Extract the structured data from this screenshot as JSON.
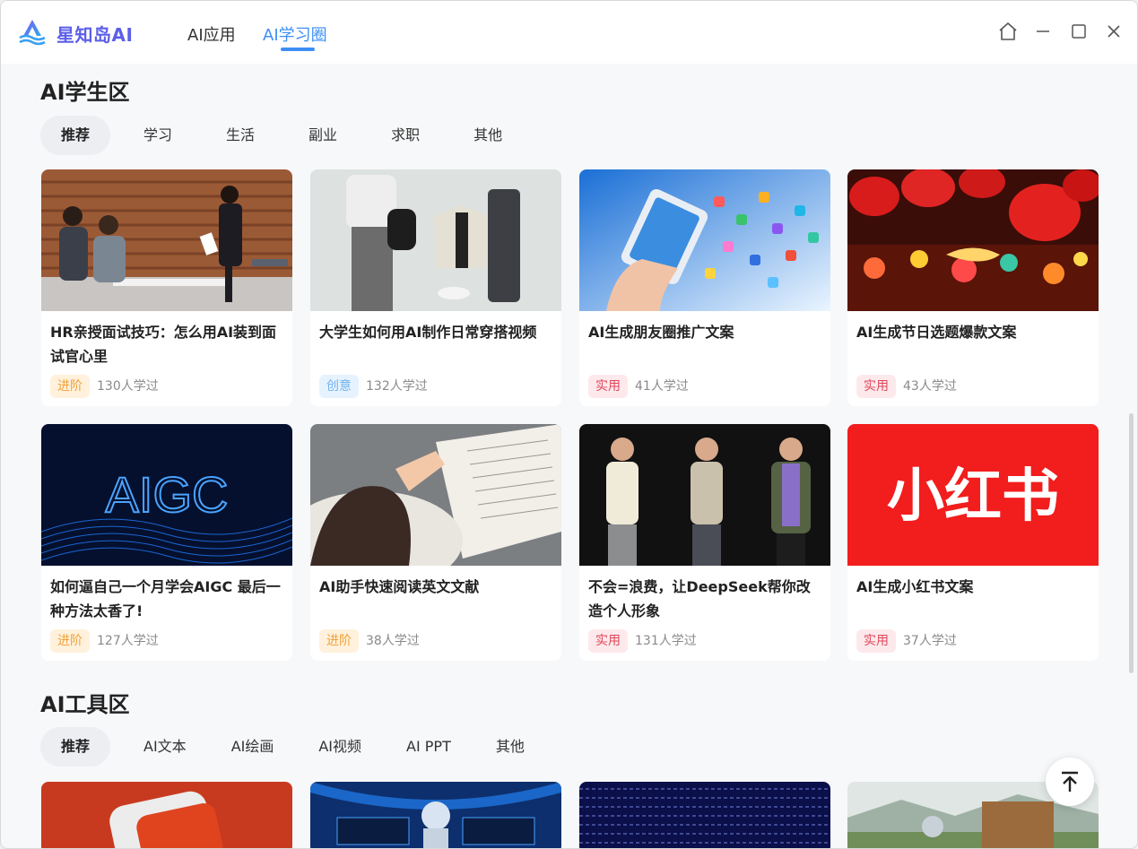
{
  "app": {
    "brand": "星知岛AI"
  },
  "nav": {
    "apps": "AI应用",
    "circle": "AI学习圈"
  },
  "student": {
    "title": "AI学生区",
    "tabs": [
      "推荐",
      "学习",
      "生活",
      "副业",
      "求职",
      "其他"
    ],
    "cards": [
      {
        "title": "HR亲授面试技巧：怎么用AI装到面试官心里",
        "tag": "进阶",
        "tag_type": "adv",
        "count": "130人学过"
      },
      {
        "title": "大学生如何用AI制作日常穿搭视频",
        "tag": "创意",
        "tag_type": "cre",
        "count": "132人学过"
      },
      {
        "title": "AI生成朋友圈推广文案",
        "tag": "实用",
        "tag_type": "pra",
        "count": "41人学过"
      },
      {
        "title": "AI生成节日选题爆款文案",
        "tag": "实用",
        "tag_type": "pra",
        "count": "43人学过"
      },
      {
        "title": "如何逼自己一个月学会AIGC 最后一种方法太香了!",
        "tag": "进阶",
        "tag_type": "adv",
        "count": "127人学过",
        "image_text": "AIGC"
      },
      {
        "title": "AI助手快速阅读英文文献",
        "tag": "进阶",
        "tag_type": "adv",
        "count": "38人学过"
      },
      {
        "title": "不会=浪费，让DeepSeek帮你改造个人形象",
        "tag": "实用",
        "tag_type": "pra",
        "count": "131人学过"
      },
      {
        "title": "AI生成小红书文案",
        "tag": "实用",
        "tag_type": "pra",
        "count": "37人学过",
        "image_text": "小红书"
      }
    ]
  },
  "tools": {
    "title": "AI工具区",
    "tabs": [
      "推荐",
      "AI文本",
      "AI绘画",
      "AI视频",
      "AI PPT",
      "其他"
    ]
  },
  "colors": {
    "accent": "#3d8ff5",
    "brand": "#5b5fe8",
    "xhs_red": "#f21d1d"
  },
  "icons": {
    "home": "home-icon",
    "minimize": "minimize-icon",
    "maximize": "maximize-icon",
    "close": "close-icon",
    "back_to_top": "arrow-up-icon"
  }
}
